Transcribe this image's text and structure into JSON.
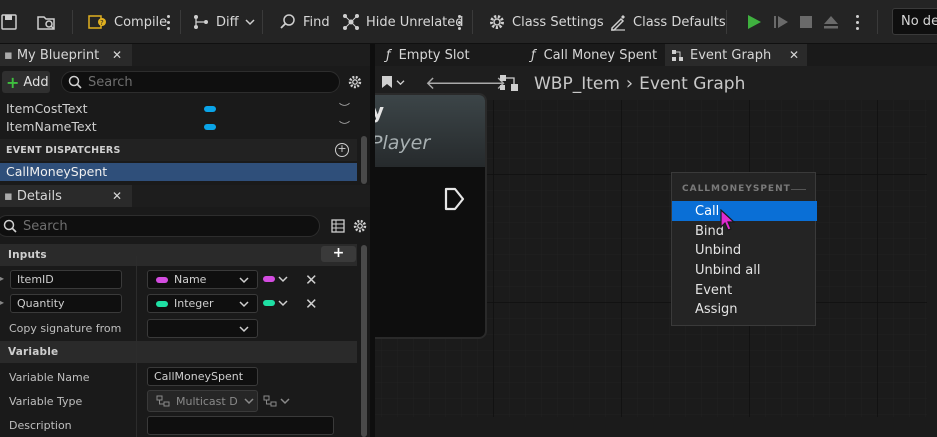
{
  "toolbar": {
    "compile_label": "Compile",
    "diff_label": "Diff",
    "find_label": "Find",
    "hide_unrelated_label": "Hide Unrelated",
    "class_settings_label": "Class Settings",
    "class_defaults_label": "Class Defaults",
    "debug_dropdown_label": "No deb"
  },
  "my_blueprint": {
    "tab_label": "My Blueprint",
    "add_label": "Add",
    "search_placeholder": "Search",
    "variables": [
      {
        "name": "ItemCostText"
      },
      {
        "name": "ItemNameText"
      }
    ],
    "event_dispatchers_header": "EVENT DISPATCHERS",
    "dispatchers": [
      {
        "name": "CallMoneySpent"
      }
    ]
  },
  "details": {
    "tab_label": "Details",
    "search_placeholder": "Search",
    "inputs_header": "Inputs",
    "inputs": [
      {
        "name": "ItemID",
        "type": "Name",
        "color": "#d34ce0"
      },
      {
        "name": "Quantity",
        "type": "Integer",
        "color": "#1fe0a4"
      }
    ],
    "copy_signature_label": "Copy signature from",
    "variable_header": "Variable",
    "variable_name_label": "Variable Name",
    "variable_name_value": "CallMoneySpent",
    "variable_type_label": "Variable Type",
    "variable_type_value": "Multicast Deleg",
    "description_label": "Description"
  },
  "editor_tabs": [
    {
      "label": "Empty Slot",
      "prefix": "f"
    },
    {
      "label": "Call Money Spent",
      "prefix": "f"
    },
    {
      "label": "Event Graph",
      "prefix": "grid"
    }
  ],
  "breadcrumb": {
    "root": "WBP_Item",
    "current": "Event Graph"
  },
  "graph_node": {
    "title_fragment": "y",
    "subtitle_fragment": "Player"
  },
  "context_menu": {
    "header": "CALLMONEYSPENT",
    "items": [
      {
        "label": "Call",
        "selected": true
      },
      {
        "label": "Bind"
      },
      {
        "label": "Unbind"
      },
      {
        "label": "Unbind all"
      },
      {
        "label": "Event"
      },
      {
        "label": "Assign"
      }
    ]
  },
  "colors": {
    "selection_blue": "#0a6fd6",
    "variable_pill": "#0aa4e8",
    "play_green": "#3fb03f",
    "cursor_magenta": "#e02ad0"
  }
}
